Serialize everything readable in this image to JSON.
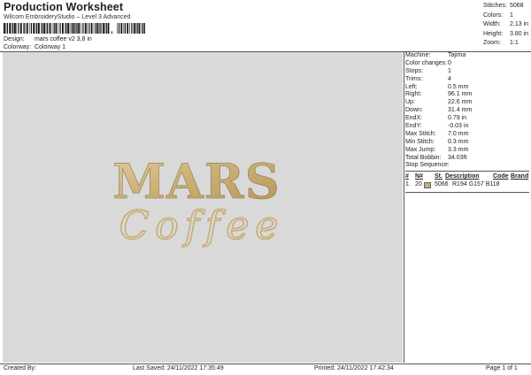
{
  "header": {
    "title": "Production Worksheet",
    "subtitle": "Wilcom EmbroideryStudio – Level 3 Advanced",
    "barcode_char": ",",
    "design_label": "Design:",
    "design_value": "mars coffee v2 3,8 in",
    "colorway_label": "Colorway:",
    "colorway_value": "Colorway 1"
  },
  "summary": [
    {
      "label": "Stitches:",
      "value": "5068"
    },
    {
      "label": "Colors:",
      "value": "1"
    },
    {
      "label": "Width:",
      "value": "2.13 in"
    },
    {
      "label": "Height:",
      "value": "3.80 in"
    },
    {
      "label": "Zoom:",
      "value": "1:1"
    }
  ],
  "details": [
    {
      "label": "Machine:",
      "value": "Tajima"
    },
    {
      "label": "Color changes:",
      "value": "0"
    },
    {
      "label": "Stops:",
      "value": "1"
    },
    {
      "label": "Trims:",
      "value": "4"
    },
    {
      "label": "Left:",
      "value": "0.5 mm"
    },
    {
      "label": "Right:",
      "value": "96.1 mm"
    },
    {
      "label": "Up:",
      "value": "22.6 mm"
    },
    {
      "label": "Down:",
      "value": "31.4 mm"
    },
    {
      "label": "EndX:",
      "value": "0.79 in"
    },
    {
      "label": "EndY:",
      "value": "-0.03 in"
    },
    {
      "label": "Max Stitch:",
      "value": "7.0 mm"
    },
    {
      "label": "Min Stitch:",
      "value": "0.3 mm"
    },
    {
      "label": "Max Jump:",
      "value": "3.3 mm"
    },
    {
      "label": "Total Bobbin:",
      "value": "34.03ft"
    }
  ],
  "stop_sequence": {
    "title": "Stop Sequence:",
    "headers": {
      "num": "#",
      "n": "N#",
      "st": "St.",
      "desc": "Description",
      "code": "Code",
      "brand": "Brand"
    },
    "rows": [
      {
        "num": "1.",
        "n": "20",
        "swatch": "#c2b076",
        "st": "5066",
        "desc": "R194 G157 B118",
        "code": "",
        "brand": ""
      }
    ]
  },
  "design": {
    "word1": "MARS",
    "word2": "Coffee",
    "thread_color": "#d2b882",
    "thread_shadow": "#8f7a4e"
  },
  "footer": {
    "created": "Created By:",
    "saved": "Last Saved: 24/11/2022 17:35:49",
    "printed": "Printed: 24/11/2022 17:42:34",
    "page": "Page 1 of 1"
  }
}
